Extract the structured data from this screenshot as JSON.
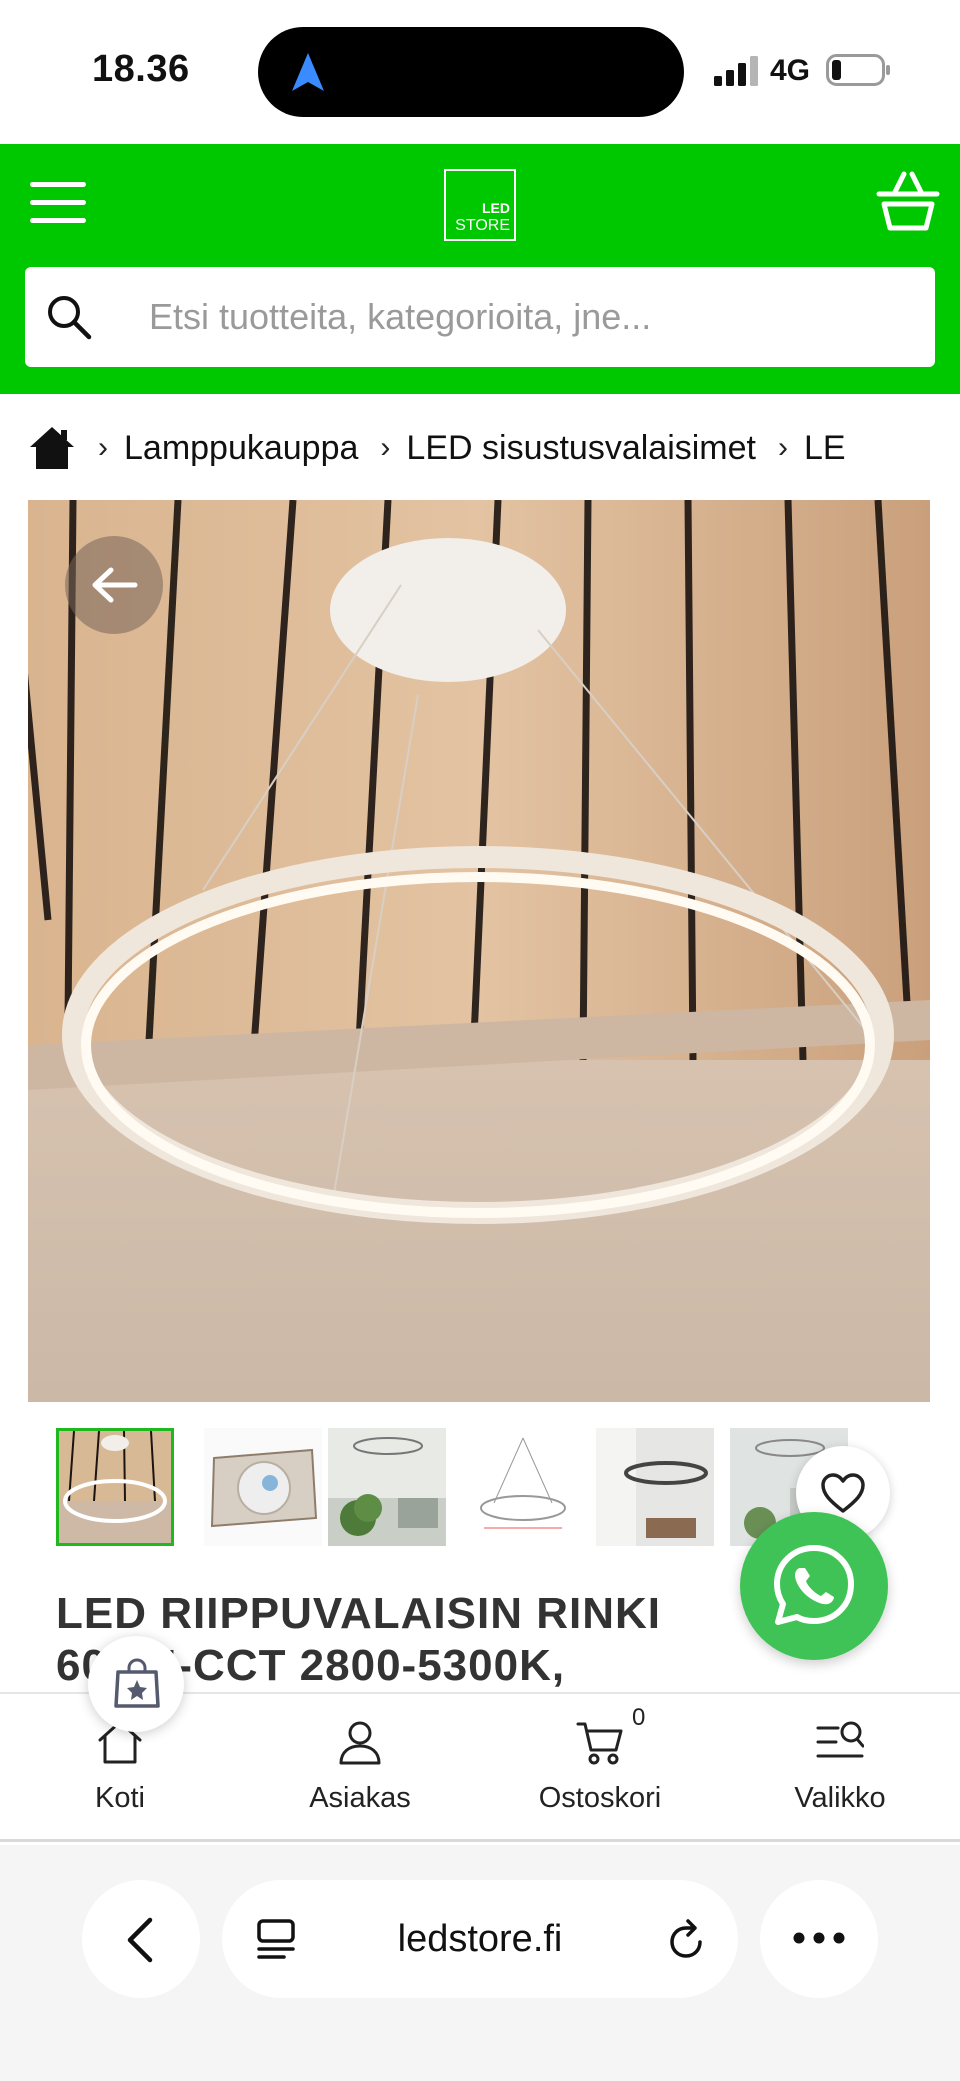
{
  "status_bar": {
    "time": "18.36",
    "network": "4G",
    "icons": [
      "location-arrow-icon",
      "signal-icon",
      "battery-icon"
    ]
  },
  "header": {
    "logo": {
      "line1": "LED",
      "line2": "STORE"
    },
    "menu_icon": "menu-icon",
    "cart_icon": "basket-icon",
    "search": {
      "placeholder": "Etsi tuotteita, kategorioita, jne...",
      "value": ""
    }
  },
  "breadcrumb": {
    "home_icon": "home-icon",
    "items": [
      "Lamppukauppa",
      "LED sisustusvalaisimet",
      "LE"
    ]
  },
  "product": {
    "title_line1": "LED RIIPPUVALAISIN RINKI",
    "title_line2": "60CM-CCT 2800-5300K,",
    "thumbnails_count": 6,
    "active_thumbnail": 1
  },
  "bottom_nav": {
    "items": [
      {
        "label": "Koti",
        "icon": "home-outline-icon"
      },
      {
        "label": "Asiakas",
        "icon": "user-icon"
      },
      {
        "label": "Ostoskori",
        "icon": "cart-icon"
      },
      {
        "label": "Valikko",
        "icon": "menu-search-icon"
      }
    ],
    "cart_count": "0"
  },
  "browser": {
    "url": "ledstore.fi"
  },
  "colors": {
    "brand_green": "#00c800",
    "whatsapp_green": "#3fc356",
    "active_thumb_border": "#1fb81f"
  }
}
